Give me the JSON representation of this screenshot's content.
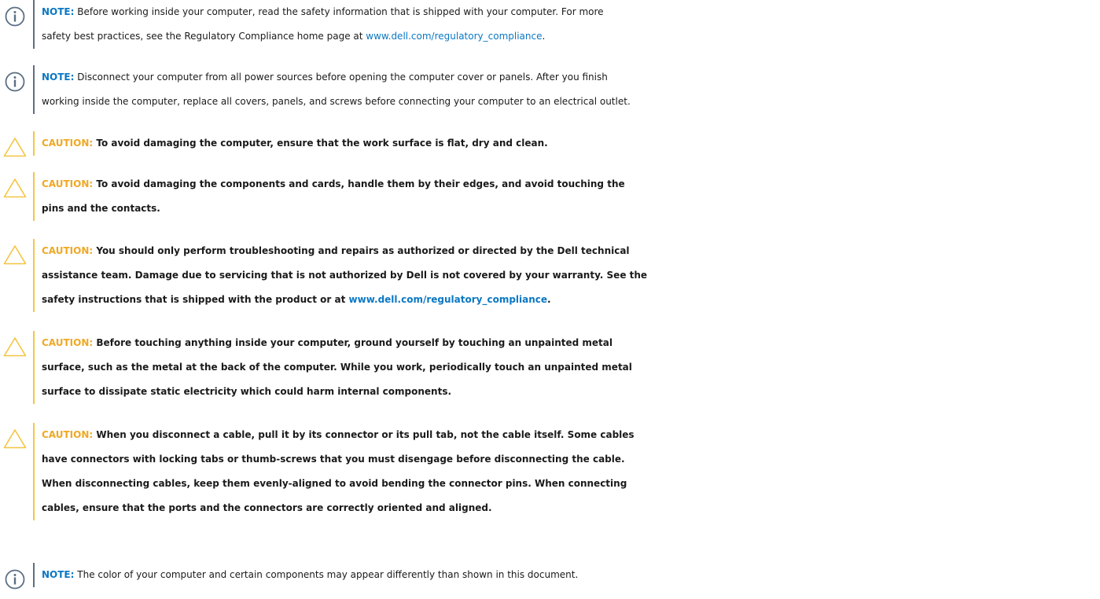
{
  "colors": {
    "note_accent": "#0a78c4",
    "note_bar": "#5b6f85",
    "caution_accent": "#f0a824",
    "caution_bar": "#f4c542",
    "link": "#0a78c4"
  },
  "icons": {
    "note": "info-circle-icon",
    "caution": "warning-triangle-icon"
  },
  "notices": {
    "n1": {
      "label": "NOTE:",
      "line1": " Before working inside your computer, read the safety information that is shipped with your computer. For more",
      "line2_pre": "safety best practices, see the Regulatory Compliance home page at ",
      "link": "www.dell.com/regulatory_compliance",
      "line2_post": "."
    },
    "n2": {
      "label": "NOTE:",
      "line1": " Disconnect your computer from all power sources before opening the computer cover or panels. After you finish",
      "line2": "working inside the computer, replace all covers, panels, and screws before connecting your computer to an electrical outlet."
    },
    "c1": {
      "label": "CAUTION:",
      "line1": " To avoid damaging the computer, ensure that the work surface is flat, dry and clean."
    },
    "c2": {
      "label": "CAUTION:",
      "line1": " To avoid damaging the components and cards, handle them by their edges, and avoid touching the",
      "line2": "pins and the contacts."
    },
    "c3": {
      "label": "CAUTION:",
      "line1": " You should only perform troubleshooting and repairs as authorized or directed by the Dell technical",
      "line2": "assistance team. Damage due to servicing that is not authorized by Dell is not covered by your warranty. See the",
      "line3_pre": "safety instructions that is shipped with the product or at ",
      "link": "www.dell.com/regulatory_compliance",
      "line3_post": "."
    },
    "c4": {
      "label": "CAUTION:",
      "line1": " Before touching anything inside your computer, ground yourself by touching an unpainted metal",
      "line2": "surface, such as the metal at the back of the computer. While you work, periodically touch an unpainted metal",
      "line3": "surface to dissipate static electricity which could harm internal components."
    },
    "c5": {
      "label": "CAUTION:",
      "line1": " When you disconnect a cable, pull it by its connector or its pull tab, not the cable itself. Some cables",
      "line2": "have connectors with locking tabs or thumb-screws that you must disengage before disconnecting the cable.",
      "line3": "When disconnecting cables, keep them evenly-aligned to avoid bending the connector pins. When connecting",
      "line4": "cables, ensure that the ports and the connectors are correctly oriented and aligned."
    },
    "n3": {
      "label": "NOTE:",
      "line1": " The color of your computer and certain components may appear differently than shown in this document."
    }
  }
}
